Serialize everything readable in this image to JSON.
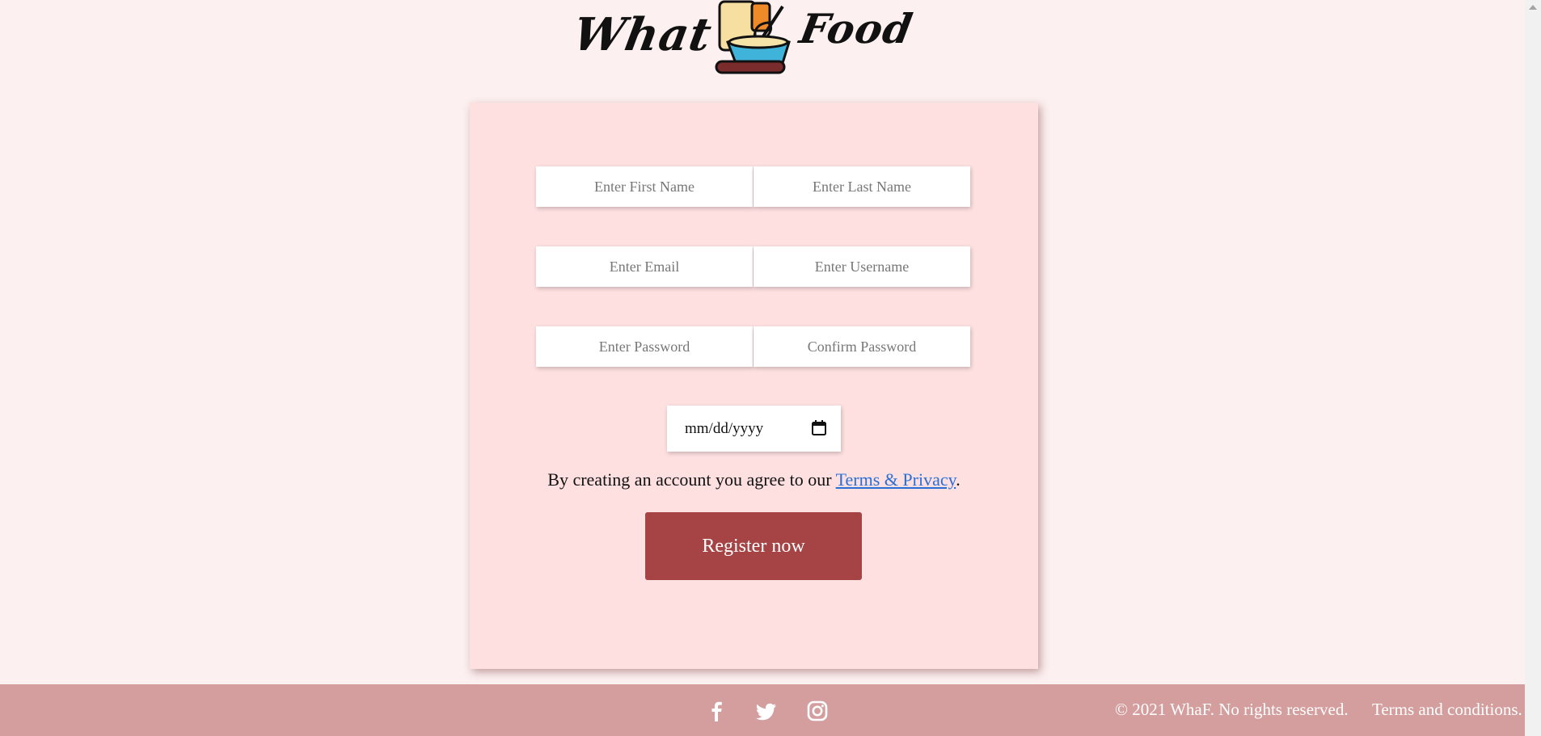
{
  "brand": {
    "logo_word_1": "What",
    "logo_word_2": "Food"
  },
  "form": {
    "first_name_placeholder": "Enter First Name",
    "last_name_placeholder": "Enter Last Name",
    "email_placeholder": "Enter Email",
    "username_placeholder": "Enter Username",
    "password_placeholder": "Enter Password",
    "confirm_password_placeholder": "Confirm Password",
    "date_placeholder": "mm/dd/yyyy",
    "agree_text": "By creating an account you agree to our ",
    "terms_link": "Terms & Privacy",
    "agree_end": ".",
    "register_label": "Register now"
  },
  "footer": {
    "social_icons": [
      "facebook-icon",
      "twitter-icon",
      "instagram-icon"
    ],
    "copyright": "© 2021 WhaF. No rights reserved.",
    "terms": "Terms and conditions."
  },
  "colors": {
    "page_bg": "#fdf0f0",
    "card_bg": "#fee0e1",
    "button_bg": "#a64345",
    "footer_bg": "#d49e9e",
    "link": "#2a6fd6"
  }
}
